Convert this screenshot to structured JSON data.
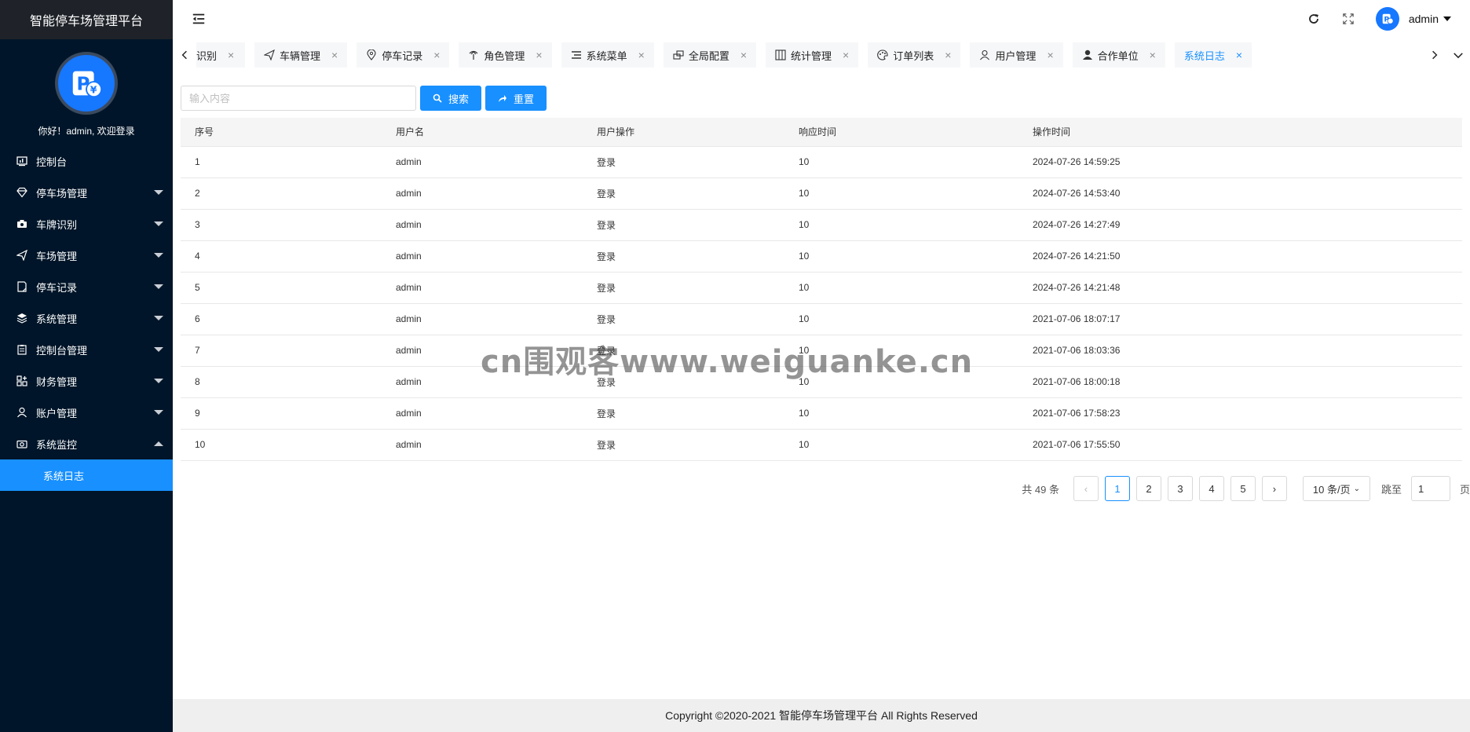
{
  "brand": "智能停车场管理平台",
  "welcome": "你好！admin, 欢迎登录",
  "menu": [
    {
      "label": "控制台",
      "icon": "dashboard-icon",
      "caret": "none"
    },
    {
      "label": "停车场管理",
      "icon": "diamond-icon",
      "caret": "down"
    },
    {
      "label": "车牌识别",
      "icon": "camera-icon",
      "caret": "down"
    },
    {
      "label": "车场管理",
      "icon": "send-icon",
      "caret": "down"
    },
    {
      "label": "停车记录",
      "icon": "note-icon",
      "caret": "down"
    },
    {
      "label": "系统管理",
      "icon": "layers-icon",
      "caret": "down"
    },
    {
      "label": "控制台管理",
      "icon": "clipboard-icon",
      "caret": "down"
    },
    {
      "label": "财务管理",
      "icon": "grid-plus-icon",
      "caret": "down"
    },
    {
      "label": "账户管理",
      "icon": "user-icon",
      "caret": "down"
    },
    {
      "label": "系统监控",
      "icon": "camera-outline-icon",
      "caret": "up"
    }
  ],
  "submenu_active": "系统日志",
  "header": {
    "user": "admin"
  },
  "tabs": [
    {
      "label": "识别",
      "display": "识别",
      "active": false
    },
    {
      "label": "车辆管理",
      "active": false
    },
    {
      "label": "停车记录",
      "active": false
    },
    {
      "label": "角色管理",
      "active": false
    },
    {
      "label": "系统菜单",
      "active": false
    },
    {
      "label": "全局配置",
      "active": false
    },
    {
      "label": "统计管理",
      "active": false
    },
    {
      "label": "订单列表",
      "active": false
    },
    {
      "label": "用户管理",
      "active": false
    },
    {
      "label": "合作单位",
      "active": false
    },
    {
      "label": "系统日志",
      "active": true
    }
  ],
  "toolbar": {
    "search_placeholder": "输入内容",
    "search_label": "搜索",
    "reset_label": "重置"
  },
  "table": {
    "columns": [
      "序号",
      "用户名",
      "用户操作",
      "响应时间",
      "操作时间"
    ],
    "rows": [
      [
        "1",
        "admin",
        "登录",
        "10",
        "2024-07-26 14:59:25"
      ],
      [
        "2",
        "admin",
        "登录",
        "10",
        "2024-07-26 14:53:40"
      ],
      [
        "3",
        "admin",
        "登录",
        "10",
        "2024-07-26 14:27:49"
      ],
      [
        "4",
        "admin",
        "登录",
        "10",
        "2024-07-26 14:21:50"
      ],
      [
        "5",
        "admin",
        "登录",
        "10",
        "2024-07-26 14:21:48"
      ],
      [
        "6",
        "admin",
        "登录",
        "10",
        "2021-07-06 18:07:17"
      ],
      [
        "7",
        "admin",
        "登录",
        "10",
        "2021-07-06 18:03:36"
      ],
      [
        "8",
        "admin",
        "登录",
        "10",
        "2021-07-06 18:00:18"
      ],
      [
        "9",
        "admin",
        "登录",
        "10",
        "2021-07-06 17:58:23"
      ],
      [
        "10",
        "admin",
        "登录",
        "10",
        "2021-07-06 17:55:50"
      ]
    ]
  },
  "pagination": {
    "total_text": "共 49 条",
    "pages": [
      "1",
      "2",
      "3",
      "4",
      "5"
    ],
    "current": "1",
    "page_size": "10 条/页",
    "jump_label": "跳至",
    "jump_value": "1",
    "page_suffix": "页"
  },
  "watermark": "cn围观客www.weiguanke.cn",
  "footer": "Copyright ©2020-2021 智能停车场管理平台 All Rights Reserved",
  "colors": {
    "sidebar": "#001529",
    "accent": "#1890ff"
  }
}
